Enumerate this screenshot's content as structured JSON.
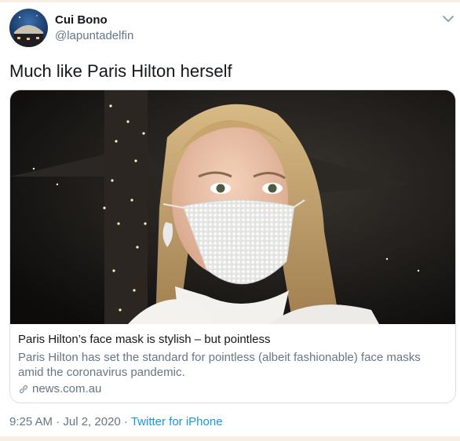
{
  "tweet": {
    "author_name": "Cui Bono",
    "author_handle": "@lapuntadelfin",
    "text": "Much like Paris Hilton herself",
    "card": {
      "title": "Paris Hilton’s face mask is stylish – but pointless",
      "description": "Paris Hilton has set the standard for pointless (albeit fashionable) face masks amid the coronavirus pandemic.",
      "domain": "news.com.au"
    },
    "timestamp": "9:25 AM · Jul 2, 2020",
    "separator": " · ",
    "source": "Twitter for iPhone"
  },
  "icons": [
    "chevron-down-icon",
    "link-icon"
  ],
  "colors": {
    "link_blue": "#1b95e0",
    "secondary_text": "#657786",
    "primary_text": "#14171a"
  }
}
